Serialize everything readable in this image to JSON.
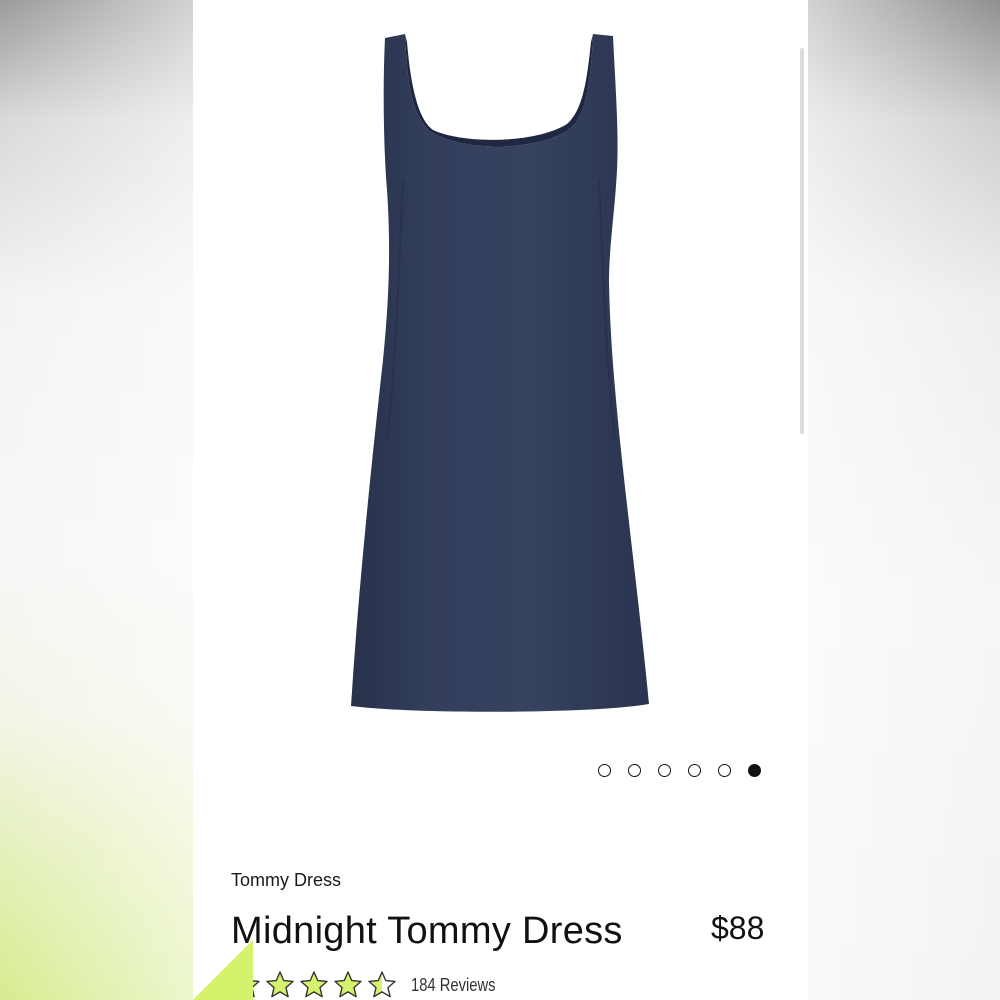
{
  "product": {
    "collection": "Tommy Dress",
    "name": "Midnight Tommy Dress",
    "price": "$88",
    "image_icon": "dress-image",
    "color": "#2f3a55"
  },
  "carousel": {
    "total": 6,
    "active_index": 6
  },
  "rating": {
    "stars": 4.5,
    "max": 5,
    "star_fill_color": "#d4f26b",
    "reviews_label": "184 Reviews"
  },
  "colors": {
    "accent": "#d4f26b",
    "text": "#111111"
  }
}
